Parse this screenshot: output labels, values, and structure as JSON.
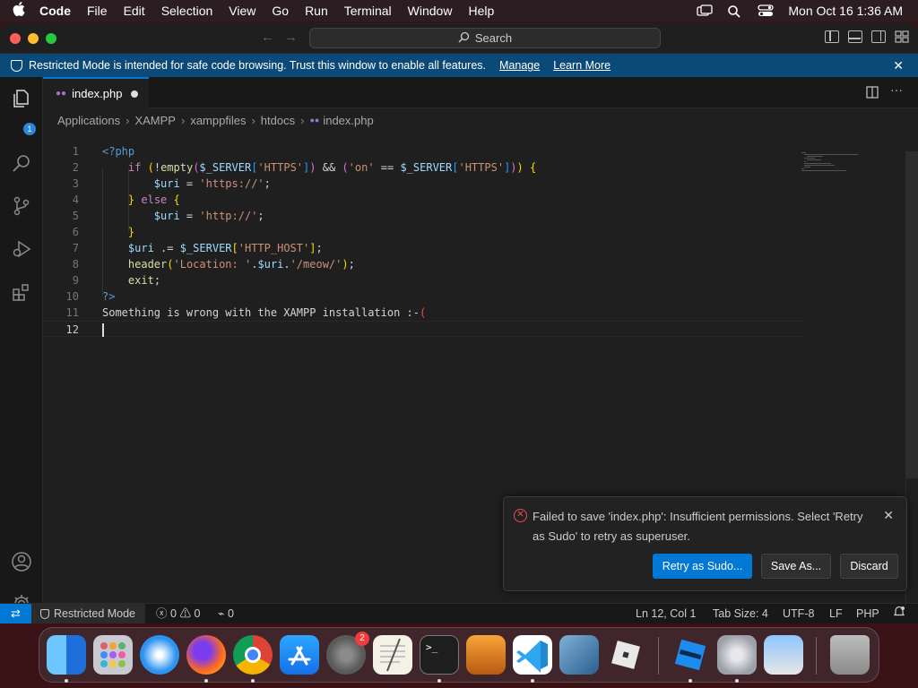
{
  "menubar": {
    "apple": "",
    "items": [
      "Code",
      "File",
      "Edit",
      "Selection",
      "View",
      "Go",
      "Run",
      "Terminal",
      "Window",
      "Help"
    ],
    "clock": "Mon Oct 16  1:36 AM"
  },
  "titlebar": {
    "search_label": "Search"
  },
  "banner": {
    "text": "Restricted Mode is intended for safe code browsing. Trust this window to enable all features.",
    "manage": "Manage",
    "learn_more": "Learn More",
    "close": "✕"
  },
  "activity": {
    "explorer_badge": "1"
  },
  "tab": {
    "label": "index.php",
    "icon_text": "php"
  },
  "breadcrumb": [
    "Applications",
    "XAMPP",
    "xamppfiles",
    "htdocs",
    "index.php"
  ],
  "editor": {
    "line_numbers": [
      "1",
      "2",
      "3",
      "4",
      "5",
      "6",
      "7",
      "8",
      "9",
      "10",
      "11",
      "12"
    ],
    "current_line": "12"
  },
  "notification": {
    "message": "Failed to save 'index.php': Insufficient permissions. Select 'Retry as Sudo' to retry as superuser.",
    "retry_button": "Retry as Sudo...",
    "save_as_button": "Save As...",
    "discard_button": "Discard"
  },
  "statusbar": {
    "restricted": "Restricted Mode",
    "errors": "0",
    "warnings": "0",
    "ports": "0",
    "position": "Ln 12, Col 1",
    "tab_size": "Tab Size: 4",
    "encoding": "UTF-8",
    "eol": "LF",
    "language": "PHP"
  },
  "dock": {
    "settings_badge": "2",
    "apps": [
      "finder-icon",
      "launchpad-icon",
      "safari-icon",
      "firefox-icon",
      "chrome-icon",
      "app-store-icon",
      "system-settings-icon",
      "textedit-icon",
      "terminal-icon",
      "garageband-icon",
      "vscode-icon",
      "virtualbox-icon",
      "roblox-icon",
      "roblox-studio-icon",
      "system-preferences-icon",
      "preview-icon",
      "trash-icon"
    ]
  },
  "colors": {
    "accent": "#0078d4",
    "banner": "#0b4a78",
    "error": "#f14c4c"
  }
}
